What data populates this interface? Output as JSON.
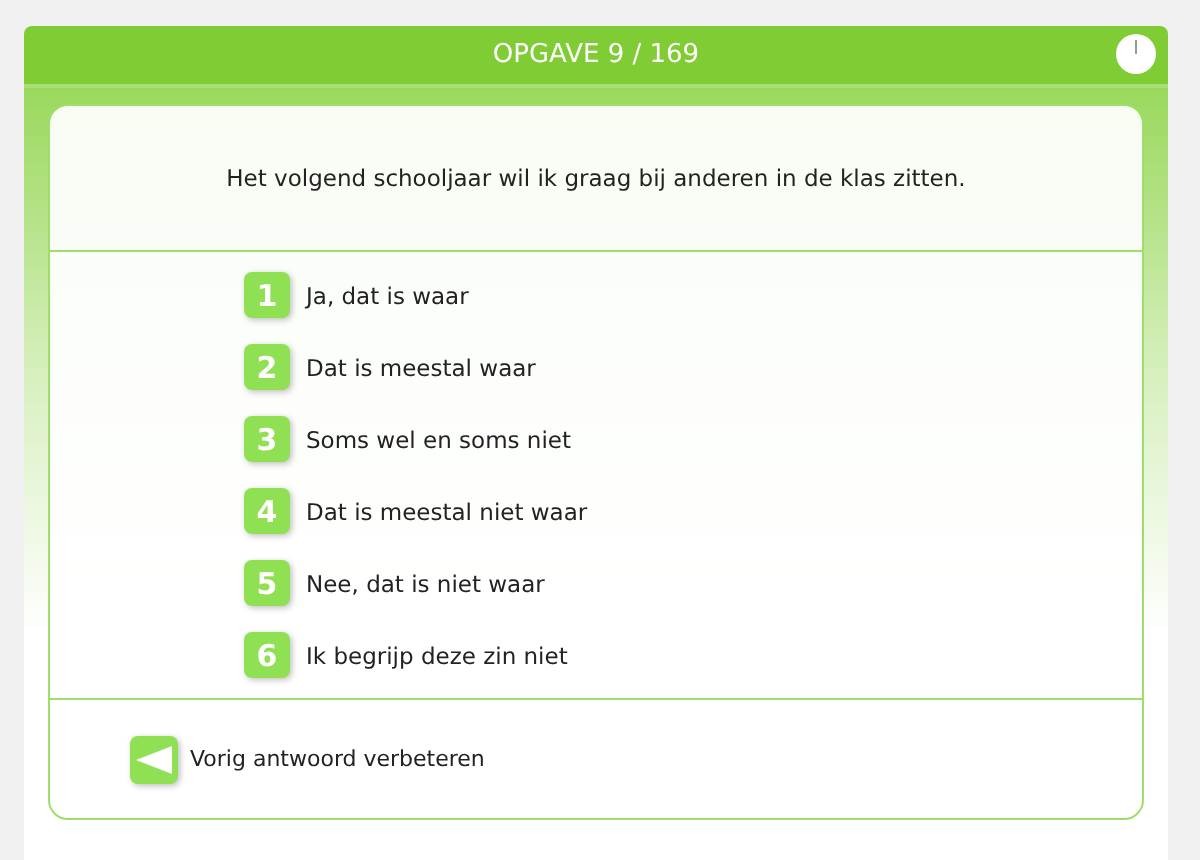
{
  "header": {
    "title": "OPGAVE 9 / 169"
  },
  "question": "Het volgend schooljaar wil ik graag bij anderen in de klas zitten.",
  "answers": [
    {
      "number": "1",
      "label": "Ja, dat is waar"
    },
    {
      "number": "2",
      "label": "Dat is meestal waar"
    },
    {
      "number": "3",
      "label": "Soms wel en soms niet"
    },
    {
      "number": "4",
      "label": "Dat is meestal niet waar"
    },
    {
      "number": "5",
      "label": "Nee, dat is niet waar"
    },
    {
      "number": "6",
      "label": "Ik begrijp deze zin niet"
    }
  ],
  "back_button": {
    "label": "Vorig antwoord verbeteren"
  }
}
